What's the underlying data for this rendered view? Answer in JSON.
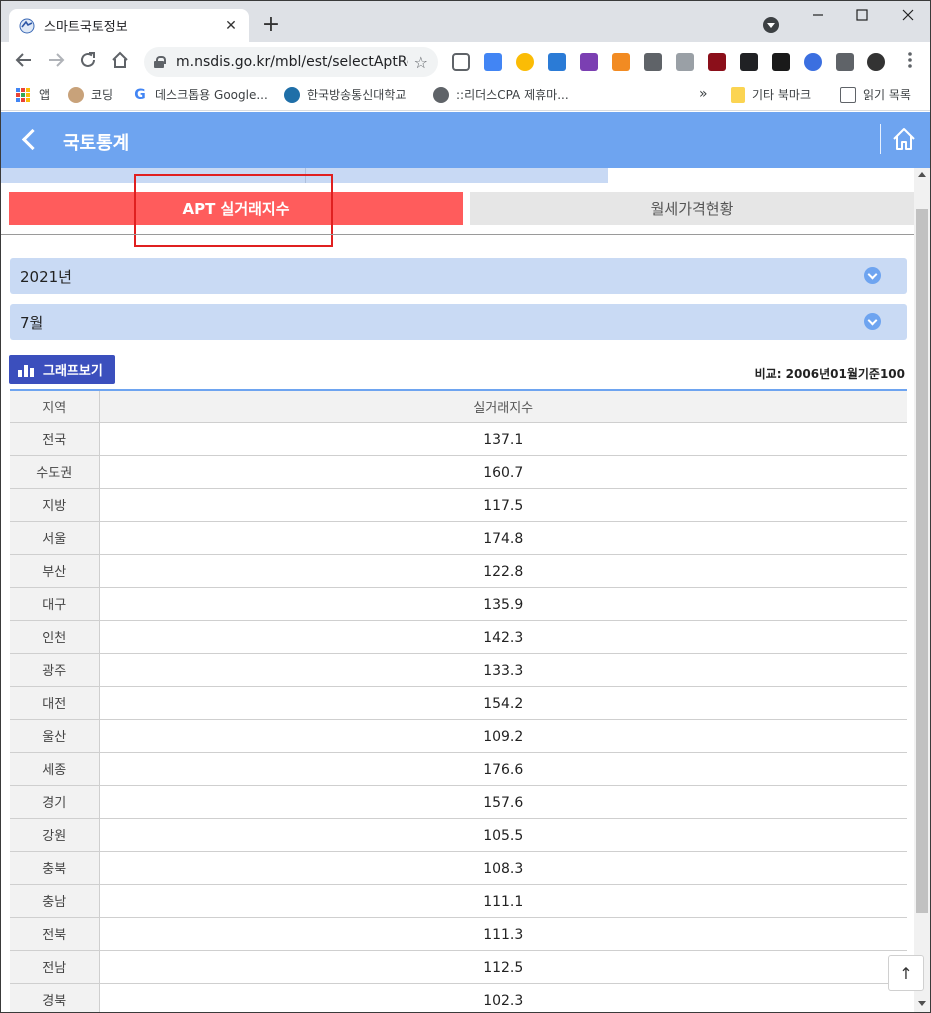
{
  "browser": {
    "tab_title": "스마트국토정보",
    "tab_close": "✕",
    "new_tab": "+",
    "url": "m.nsdis.go.kr/mbl/est/selectAptRe...",
    "bookmarks": [
      {
        "label": "앱"
      },
      {
        "label": "코딩"
      },
      {
        "label": "데스크톱용 Google..."
      },
      {
        "label": "한국방송통신대학교"
      },
      {
        "label": "::리더스CPA 제휴마..."
      }
    ],
    "bookmarks_more": "»",
    "other_bookmarks": "기타 북마크",
    "reading_list": "읽기 목록"
  },
  "header": {
    "title": "국토통계"
  },
  "tabs": {
    "active": "APT 실거래지수",
    "inactive": "월세가격현황"
  },
  "filters": {
    "year": "2021년",
    "month": "7월"
  },
  "graph_button": "그래프보기",
  "compare_note": "비교: 2006년01월기준100",
  "table": {
    "headers": {
      "region": "지역",
      "value": "실거래지수"
    },
    "rows": [
      {
        "region": "전국",
        "value": "137.1"
      },
      {
        "region": "수도권",
        "value": "160.7"
      },
      {
        "region": "지방",
        "value": "117.5"
      },
      {
        "region": "서울",
        "value": "174.8"
      },
      {
        "region": "부산",
        "value": "122.8"
      },
      {
        "region": "대구",
        "value": "135.9"
      },
      {
        "region": "인천",
        "value": "142.3"
      },
      {
        "region": "광주",
        "value": "133.3"
      },
      {
        "region": "대전",
        "value": "154.2"
      },
      {
        "region": "울산",
        "value": "109.2"
      },
      {
        "region": "세종",
        "value": "176.6"
      },
      {
        "region": "경기",
        "value": "157.6"
      },
      {
        "region": "강원",
        "value": "105.5"
      },
      {
        "region": "충북",
        "value": "108.3"
      },
      {
        "region": "충남",
        "value": "111.1"
      },
      {
        "region": "전북",
        "value": "111.3"
      },
      {
        "region": "전남",
        "value": "112.5"
      },
      {
        "region": "경북",
        "value": "102.3"
      }
    ]
  },
  "to_top": "↑",
  "colors": {
    "header_blue": "#6ea4f0",
    "active_tab_red": "#ff5c5c",
    "highlight_red": "#e02020",
    "graph_button": "#3b4fbd"
  }
}
